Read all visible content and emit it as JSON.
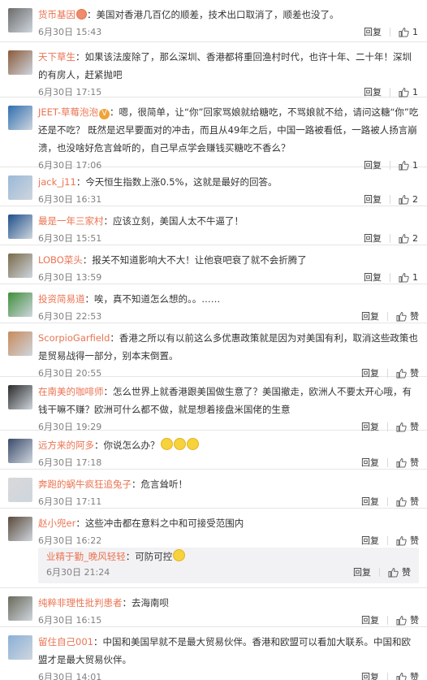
{
  "colors": {
    "name": "#eb7350",
    "time": "#808080",
    "sub_bg": "#f2f2f5"
  },
  "reply_label": "回复",
  "like_label": "赞",
  "comments": [
    {
      "name": "货币基因",
      "badge": "🐾",
      "text": "美国对香港几百亿的顺差，技术出口取消了，顺差也没了。",
      "time": "6月30日 15:43",
      "likes": "1",
      "avatar_color": "#6b6b6b"
    },
    {
      "name": "天下草生",
      "text": "如果该法废除了，那么深圳、香港都将重回渔村时代，也许十年、二十年！深圳的有房人，赶紧抛吧",
      "time": "6月30日 17:15",
      "likes": "1",
      "avatar_color": "#8a5a3a"
    },
    {
      "name": "JEET-草莓泡泡",
      "verified": "V",
      "text": "嗯，很简单，让“你”回家骂娘就给糖吃，不骂娘就不给，请问这糖“你”吃还是不吃？   既然是迟早要面对的冲击，而且从49年之后，中国一路被看低，一路被人扬言崩溃，也没啥好危言耸听的，自己早点学会赚钱买糖吃不香么？",
      "time": "6月30日 17:06",
      "likes": "1",
      "avatar_color": "#2f6fb0"
    },
    {
      "name": "jack_j11",
      "text": "今天恒生指数上涨0.5%，这就是最好的回答。",
      "time": "6月30日 16:31",
      "likes": "2",
      "avatar_color": "#9ab8d8"
    },
    {
      "name": "最是一年三家村",
      "text": "应该立刻，美国人太不牛逼了！",
      "time": "6月30日 15:51",
      "likes": "2",
      "avatar_color": "#1f4f8a"
    },
    {
      "name": "LOBO菜头",
      "text": "报关不知道影响大不大！让他衰吧衰了就不会折腾了",
      "time": "6月30日 13:59",
      "likes": "1",
      "avatar_color": "#7a6a4a"
    },
    {
      "name": "投资简易道",
      "text": "唉，真不知道怎么想的。。……",
      "time": "6月30日 22:53",
      "likes": "赞",
      "avatar_color": "#3f8f3a"
    },
    {
      "name": "ScorpioGarfield",
      "text": "香港之所以有以前这么多优惠政策就是因为对美国有利，取消这些政策也是贸易战得一部分，别本末倒置。",
      "time": "6月30日 20:55",
      "likes": "赞",
      "avatar_color": "#c88a5a"
    },
    {
      "name": "在南美的咖啡师",
      "text": "怎么世界上就香港跟美国做生意了？美国撤走，欧洲人不要太开心哦，有钱干嘛不赚？欧洲可什么都不做，就是想着接盘米国佬的生意",
      "time": "6月30日 19:29",
      "likes": "赞",
      "avatar_color": "#2a2a2a"
    },
    {
      "name": "远方来的阿多",
      "text": "你说怎么办？",
      "emojis": 3,
      "time": "6月30日 17:18",
      "likes": "赞",
      "avatar_color": "#3a4a6a"
    },
    {
      "name": "奔跑的蜗牛疯狂追兔子",
      "text": "危言耸听！",
      "time": "6月30日 17:11",
      "likes": "赞",
      "avatar_color": "#d8d8d8"
    },
    {
      "name": "赵小兜er",
      "text": "这些冲击都在意料之中和可接受范围内",
      "time": "6月30日 16:22",
      "likes": "赞",
      "avatar_color": "#5a4a3a",
      "sub": {
        "name": "业精于勤_晚风轻轻",
        "text": "可防可控",
        "emojis": 1,
        "time": "6月30日 21:24",
        "likes": "赞"
      }
    },
    {
      "name": "纯粹非理性批判患者",
      "text": "去海南呗",
      "time": "6月30日 16:15",
      "likes": "赞",
      "avatar_color": "#6a6a5a"
    },
    {
      "name": "留住自己001",
      "text": "中国和美国早就不是最大贸易伙伴。香港和欧盟可以看加大联系。中国和欧盟才是最大贸易伙伴。",
      "time": "6月30日 14:01",
      "likes": "赞",
      "avatar_color": "#8ab0d8"
    }
  ]
}
